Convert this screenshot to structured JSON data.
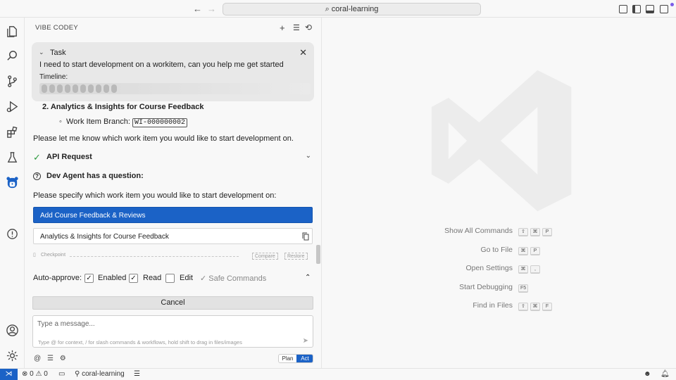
{
  "titlebar": {
    "search_text": "coral-learning"
  },
  "sidebar": {
    "title": "VIBE CODEY",
    "task": {
      "label": "Task",
      "text": "I need to start development on a workitem, can you help me get started",
      "timeline_label": "Timeline:",
      "timeline_steps": 10
    },
    "list_item": "2.  Analytics & Insights for Course Feedback",
    "branch_label": "Work Item Branch:",
    "branch_value": "WI-000000002",
    "prompt_text": "Please let me know which work item you would like to start development on.",
    "api_request_label": "API Request",
    "question_label": "Dev Agent has a question:",
    "question_text": "Please specify which work item you would like to start development on:",
    "options": [
      "Add Course Feedback & Reviews",
      "Analytics & Insights for Course Feedback"
    ],
    "checkpoint": {
      "label": "Checkpoint",
      "compare": "Compare",
      "restore": "Restore"
    },
    "auto_approve": {
      "label": "Auto-approve:",
      "enabled": "Enabled",
      "read": "Read",
      "edit": "Edit",
      "safe": "✓ Safe Commands"
    },
    "cancel_label": "Cancel",
    "message_placeholder": "Type a message...",
    "message_hint": "Type @ for context, / for slash commands & workflows, hold shift to drag in files/images",
    "mode": {
      "plan": "Plan",
      "act": "Act"
    }
  },
  "editor": {
    "shortcuts": [
      {
        "label": "Show All Commands",
        "keys": [
          "⇧",
          "⌘",
          "P"
        ]
      },
      {
        "label": "Go to File",
        "keys": [
          "⌘",
          "P"
        ]
      },
      {
        "label": "Open Settings",
        "keys": [
          "⌘",
          ","
        ]
      },
      {
        "label": "Start Debugging",
        "keys": [
          "F5"
        ]
      },
      {
        "label": "Find in Files",
        "keys": [
          "⇧",
          "⌘",
          "F"
        ]
      }
    ]
  },
  "statusbar": {
    "errors": "0",
    "warnings": "0",
    "branch": "coral-learning"
  },
  "colors": {
    "accent": "#1b62c6",
    "success": "#2d9a3e"
  }
}
